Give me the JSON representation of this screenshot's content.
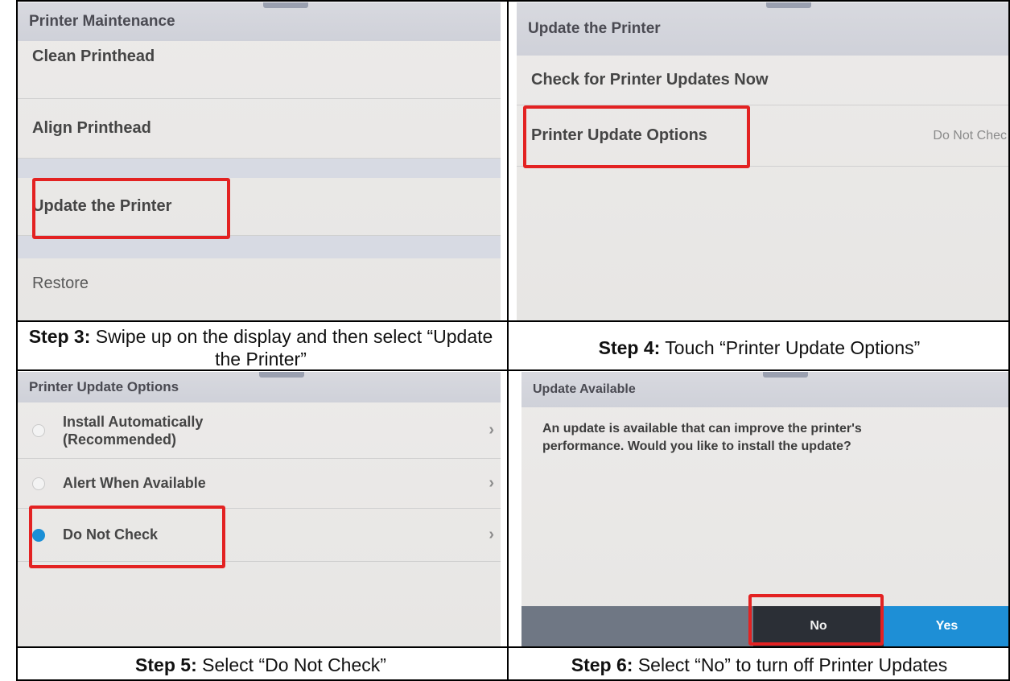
{
  "steps": [
    {
      "title": "Printer Maintenance",
      "rows": [
        "Clean Printhead",
        "Align Printhead",
        "Update the Printer",
        "Restore"
      ],
      "caption_step": "Step 3:",
      "caption_text": " Swipe up on the display and then select “Update the Printer”"
    },
    {
      "title": "Update the Printer",
      "rows": [
        "Check for Printer Updates Now",
        "Printer Update Options"
      ],
      "row_value": "Do Not Chec",
      "caption_step": "Step 4:",
      "caption_text": " Touch “Printer Update Options”"
    },
    {
      "title": "Printer Update Options",
      "options": [
        "Install Automatically",
        "(Recommended)",
        "Alert When Available",
        "Do Not Check"
      ],
      "selected": "Do Not Check",
      "caption_step": "Step 5:",
      "caption_text": " Select “Do Not Check”"
    },
    {
      "title": "Update Available",
      "message_line1": "An update is available that can improve the printer's",
      "message_line2": "performance. Would you like to install the update?",
      "no_label": "No",
      "yes_label": "Yes",
      "caption_step": "Step 6:",
      "caption_text": " Select “No” to turn off Printer Updates"
    }
  ],
  "colors": {
    "highlight": "#e32222",
    "accent_blue": "#1a8fd6",
    "titlebar": "#d3d5dc"
  }
}
